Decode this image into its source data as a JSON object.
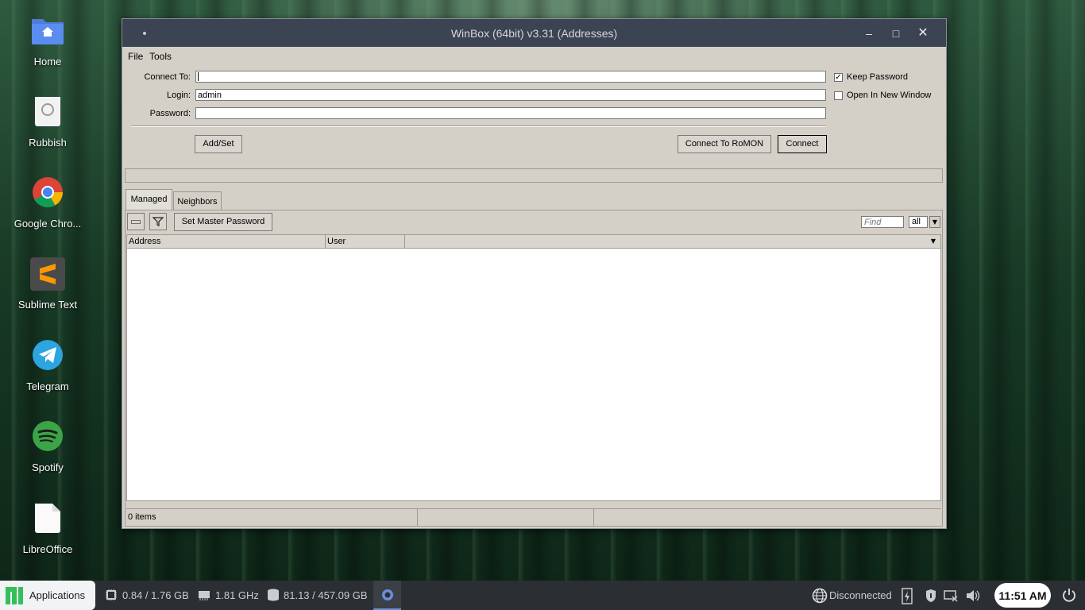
{
  "desktop": {
    "icons": [
      {
        "label": "Home",
        "icon": "home-folder-icon"
      },
      {
        "label": "Rubbish",
        "icon": "trash-icon"
      },
      {
        "label": "Google Chro...",
        "icon": "chrome-icon"
      },
      {
        "label": "Sublime Text",
        "icon": "sublime-text-icon"
      },
      {
        "label": "Telegram",
        "icon": "telegram-icon"
      },
      {
        "label": "Spotify",
        "icon": "spotify-icon"
      },
      {
        "label": "LibreOffice",
        "icon": "libreoffice-icon"
      }
    ]
  },
  "window": {
    "title": "WinBox (64bit) v3.31 (Addresses)",
    "menu": [
      "File",
      "Tools"
    ],
    "form": {
      "connect_to_label": "Connect To:",
      "connect_to_value": "",
      "login_label": "Login:",
      "login_value": "admin",
      "password_label": "Password:",
      "password_value": ""
    },
    "options": {
      "keep_password_label": "Keep Password",
      "keep_password_checked": true,
      "open_new_window_label": "Open In New Window",
      "open_new_window_checked": false
    },
    "buttons": {
      "add_set": "Add/Set",
      "connect_romon": "Connect To RoMON",
      "connect": "Connect"
    },
    "tabs": [
      "Managed",
      "Neighbors"
    ],
    "active_tab": "Managed",
    "toolbar": {
      "set_master_password": "Set Master Password",
      "find_placeholder": "Find",
      "filter_value": "all"
    },
    "table": {
      "columns": [
        "Address",
        "User"
      ],
      "rows": []
    },
    "status": {
      "items_count": "0 items"
    }
  },
  "taskbar": {
    "applications_label": "Applications",
    "cpu": "0.84 / 1.76 GB",
    "freq": "1.81 GHz",
    "disk": "81.13 / 457.09 GB",
    "network": "Disconnected",
    "clock": "11:51 AM"
  },
  "colors": {
    "titlebar": "#3c4352",
    "window_bg": "#d4d0c8",
    "taskbar": "#2b2f33",
    "manjaro_green": "#35bf5c"
  }
}
